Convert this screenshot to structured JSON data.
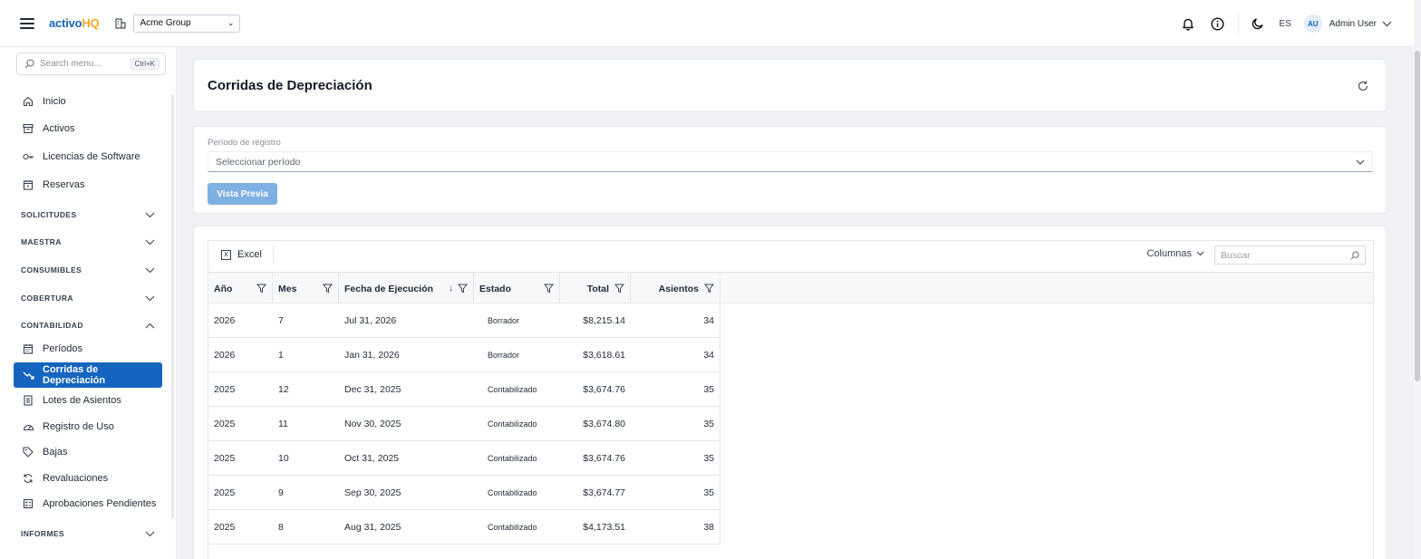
{
  "header": {
    "logo_part1": "activo",
    "logo_part2": "HQ",
    "organization": "Acme Group",
    "language": "ES",
    "user_initials": "AU",
    "user_name": "Admin User"
  },
  "sidebar": {
    "search_placeholder": "Search menu...",
    "search_shortcut": "Ctrl+K",
    "items_top": [
      {
        "label": "Inicio",
        "icon": "home-icon"
      },
      {
        "label": "Activos",
        "icon": "archive-icon"
      },
      {
        "label": "Licencias de Software",
        "icon": "key-icon"
      },
      {
        "label": "Reservas",
        "icon": "calendar-check-icon"
      }
    ],
    "sections": [
      {
        "label": "SOLICITUDES",
        "expanded": false
      },
      {
        "label": "MAESTRA",
        "expanded": false
      },
      {
        "label": "CONSUMIBLES",
        "expanded": false
      },
      {
        "label": "COBERTURA",
        "expanded": false
      },
      {
        "label": "CONTABILIDAD",
        "expanded": true
      },
      {
        "label": "INFORMES",
        "expanded": false
      }
    ],
    "accounting_items": [
      {
        "label": "Períodos",
        "icon": "calendar-icon",
        "active": false
      },
      {
        "label": "Corridas de Depreciación",
        "icon": "trending-down-icon",
        "active": true
      },
      {
        "label": "Lotes de Asientos",
        "icon": "document-list-icon",
        "active": false
      },
      {
        "label": "Registro de Uso",
        "icon": "gauge-icon",
        "active": false
      },
      {
        "label": "Bajas",
        "icon": "tag-icon",
        "active": false
      },
      {
        "label": "Revaluaciones",
        "icon": "refresh-cycle-icon",
        "active": false
      },
      {
        "label": "Aprobaciones Pendientes",
        "icon": "checklist-icon",
        "active": false
      }
    ]
  },
  "page": {
    "title": "Corridas de Depreciación",
    "period_label": "Período de registro",
    "period_placeholder": "Seleccionar período",
    "preview_button": "Vista Previa"
  },
  "grid": {
    "export_label": "Excel",
    "columns_button": "Columnas",
    "search_placeholder": "Buscar",
    "columns": [
      "Año",
      "Mes",
      "Fecha de Ejecución",
      "Estado",
      "Total",
      "Asientos"
    ],
    "sorted_column": "Fecha de Ejecución",
    "sort_direction": "descending",
    "rows": [
      {
        "year": "2026",
        "month": "7",
        "date": "Jul 31, 2026",
        "status": "Borrador",
        "total": "$8,215.14",
        "entries": "34"
      },
      {
        "year": "2026",
        "month": "1",
        "date": "Jan 31, 2026",
        "status": "Borrador",
        "total": "$3,618.61",
        "entries": "34"
      },
      {
        "year": "2025",
        "month": "12",
        "date": "Dec 31, 2025",
        "status": "Contabilizado",
        "total": "$3,674.76",
        "entries": "35"
      },
      {
        "year": "2025",
        "month": "11",
        "date": "Nov 30, 2025",
        "status": "Contabilizado",
        "total": "$3,674.80",
        "entries": "35"
      },
      {
        "year": "2025",
        "month": "10",
        "date": "Oct 31, 2025",
        "status": "Contabilizado",
        "total": "$3,674.76",
        "entries": "35"
      },
      {
        "year": "2025",
        "month": "9",
        "date": "Sep 30, 2025",
        "status": "Contabilizado",
        "total": "$3,674.77",
        "entries": "35"
      },
      {
        "year": "2025",
        "month": "8",
        "date": "Aug 31, 2025",
        "status": "Contabilizado",
        "total": "$4,173.51",
        "entries": "38"
      }
    ]
  },
  "colors": {
    "primary": "#1565c0",
    "logo_accent": "#f5a623",
    "preview_button": "#7fb0e3"
  }
}
